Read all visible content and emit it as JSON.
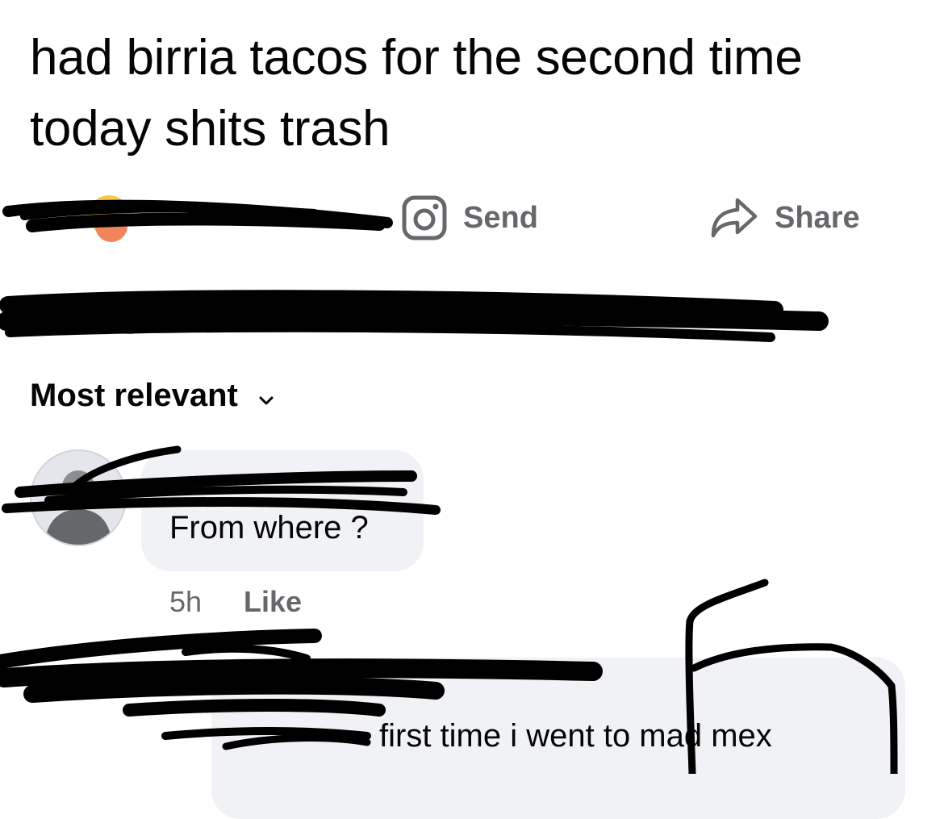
{
  "post": {
    "text": "had birria tacos for the second time today shits trash"
  },
  "actions": {
    "send_label": "Send",
    "send_icon": "instagram-icon",
    "share_label": "Share",
    "share_icon": "share-arrow-icon"
  },
  "sort": {
    "label": "Most relevant",
    "icon": "chevron-down-icon"
  },
  "comments": [
    {
      "text": "From where ?",
      "time": "5h",
      "like_label": "Like"
    }
  ],
  "reply": {
    "text": "first time i went to mad mex"
  },
  "colors": {
    "text_primary": "#050505",
    "text_secondary": "#65676b",
    "bubble": "#f0f2f5",
    "scribble": "#000000",
    "link_blue": "#216fdb"
  }
}
